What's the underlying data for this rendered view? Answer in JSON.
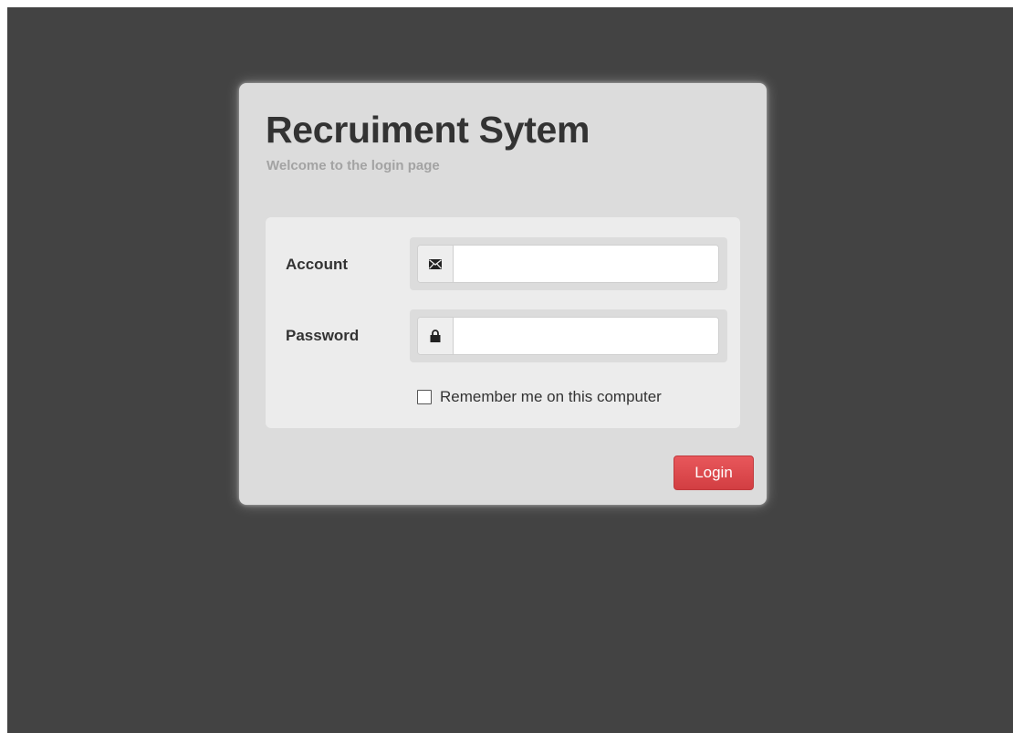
{
  "login": {
    "title": "Recruiment Sytem",
    "subtitle": "Welcome to the login page",
    "account": {
      "label": "Account",
      "value": "",
      "icon": "envelope-icon"
    },
    "password": {
      "label": "Password",
      "value": "",
      "icon": "lock-icon"
    },
    "remember": {
      "label": "Remember me on this computer",
      "checked": false
    },
    "button_label": "Login"
  },
  "colors": {
    "background": "#434343",
    "card": "#dcdcdc",
    "panel": "#ececec",
    "accent": "#d9474b"
  }
}
